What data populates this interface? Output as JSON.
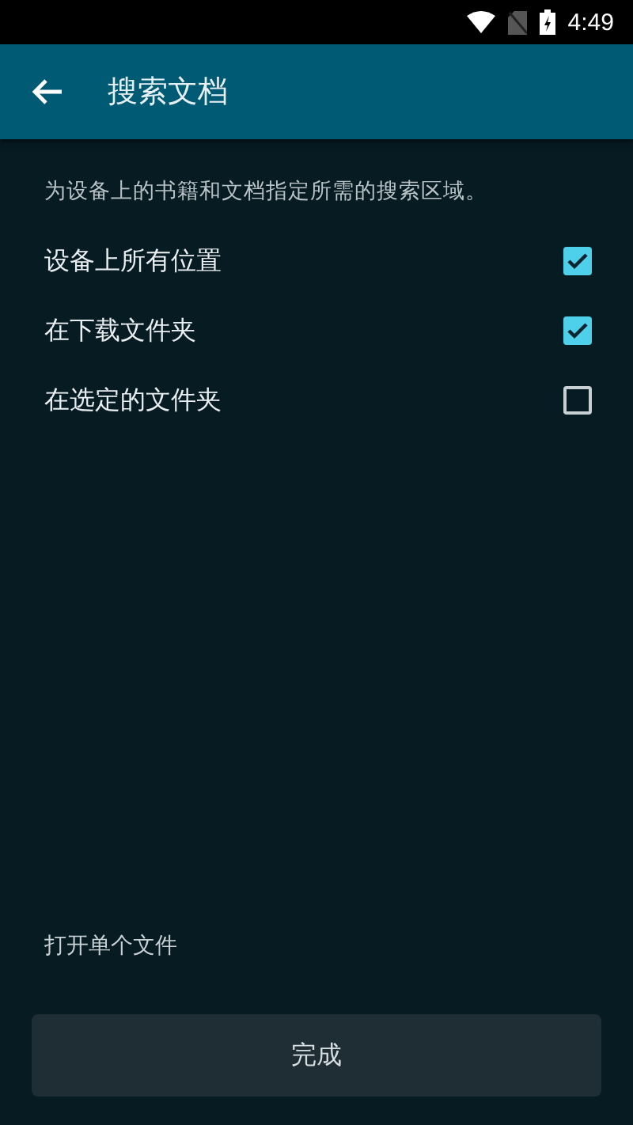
{
  "status_bar": {
    "time": "4:49"
  },
  "toolbar": {
    "title": "搜索文档"
  },
  "description": "为设备上的书籍和文档指定所需的搜索区域。",
  "options": [
    {
      "label": "设备上所有位置",
      "checked": true
    },
    {
      "label": "在下载文件夹",
      "checked": true
    },
    {
      "label": "在选定的文件夹",
      "checked": false
    }
  ],
  "open_single_file": "打开单个文件",
  "done_button": "完成"
}
